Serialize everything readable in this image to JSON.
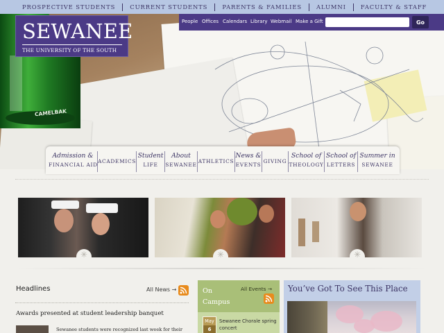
{
  "audience_nav": [
    "Prospective Students",
    "Current Students",
    "Parents & Families",
    "Alumni",
    "Faculty & Staff"
  ],
  "logo": {
    "wordmark": "SEWANEE",
    "subtitle": "THE UNIVERSITY OF THE SOUTH"
  },
  "quick_links": [
    "People",
    "Offices",
    "Calendars",
    "Library",
    "Webmail",
    "Make a Gift"
  ],
  "search": {
    "value": "",
    "button_label": "Go"
  },
  "main_nav": [
    {
      "line1": "Admission &",
      "line2": "FINANCIAL AID"
    },
    {
      "line1": "",
      "line2": "ACADEMICS"
    },
    {
      "line1": "Student",
      "line2": "LIFE"
    },
    {
      "line1": "About",
      "line2": "SEWANEE"
    },
    {
      "line1": "",
      "line2": "ATHLETICS"
    },
    {
      "line1": "News &",
      "line2": "EVENTS"
    },
    {
      "line1": "",
      "line2": "GIVING"
    },
    {
      "line1": "School of",
      "line2": "THEOLOGY"
    },
    {
      "line1": "School of",
      "line2": "LETTERS"
    },
    {
      "line1": "Summer in",
      "line2": "SEWANEE"
    }
  ],
  "bottle_label": "CAMELBAK",
  "headlines": {
    "title": "Headlines",
    "all_link": "All News →",
    "story_title": "Awards presented at student leadership banquet",
    "story_text": "Sewanee students were recognized last week for their"
  },
  "on_campus": {
    "title": "On Campus",
    "all_link": "All Events →",
    "event_month": "May",
    "event_day": "6",
    "event_title": "Sewanee Chorale spring concert"
  },
  "see_place": {
    "title": "You’ve Got To See This Place"
  },
  "colors": {
    "purple": "#4b3a86",
    "audience_bar": "#b7c7e3",
    "campus_green": "#a9bf78",
    "see_blue": "#c2cfe7",
    "rss_orange": "#e88b1d"
  }
}
